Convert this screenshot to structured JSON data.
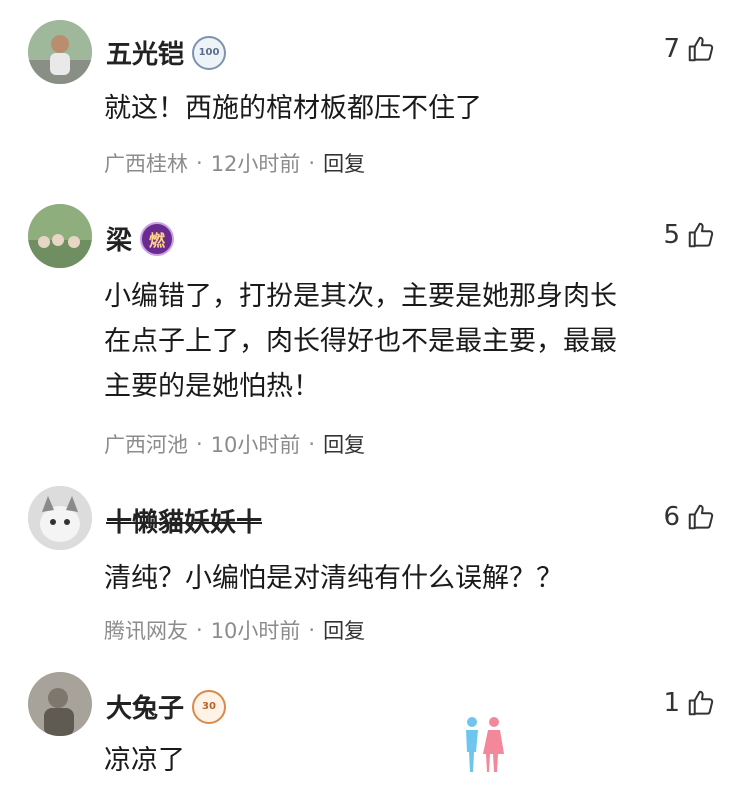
{
  "comments": [
    {
      "user": "五光铠",
      "badge": "100",
      "likes": "7",
      "text": "就这！西施的棺材板都压不住了",
      "location": "广西桂林",
      "time": "12小时前",
      "reply": "回复"
    },
    {
      "user": "梁",
      "badge": "燃",
      "likes": "5",
      "text": "小编错了，打扮是其次，主要是她那身肉长\n在点子上了，肉长得好也不是最主要，最最\n主要的是她怕热！",
      "location": "广西河池",
      "time": "10小时前",
      "reply": "回复"
    },
    {
      "user": "十懒貓妖妖十",
      "likes": "6",
      "text": "清纯？小编怕是对清纯有什么误解？？",
      "location": "腾讯网友",
      "time": "10小时前",
      "reply": "回复"
    },
    {
      "user": "大兔子",
      "badge": "30",
      "likes": "1",
      "text": "凉凉了"
    }
  ],
  "separator": "·",
  "colors": {
    "meta": "#8c8c8c",
    "text": "#1a1a1a",
    "icon": "#333333"
  },
  "icons": [
    "thumbs-up-icon",
    "level-badge-icon",
    "flame-badge-icon"
  ]
}
